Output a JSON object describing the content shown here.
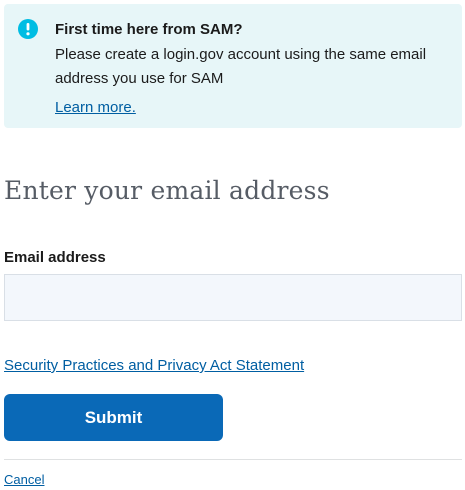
{
  "alert": {
    "icon": "info-circle-icon",
    "title": "First time here from SAM?",
    "text": "Please create a login.gov account using the same email address you use for SAM",
    "link_label": "Learn more.",
    "background_color": "#e7f6f8",
    "icon_color": "#00bde3"
  },
  "main": {
    "heading": "Enter your email address",
    "email_label": "Email address",
    "email_value": "",
    "privacy_link_label": "Security Practices and Privacy Act Statement",
    "submit_label": "Submit",
    "cancel_label": "Cancel"
  },
  "colors": {
    "primary_button": "#0a69b7",
    "link": "#005ea2",
    "heading": "#565c65"
  }
}
